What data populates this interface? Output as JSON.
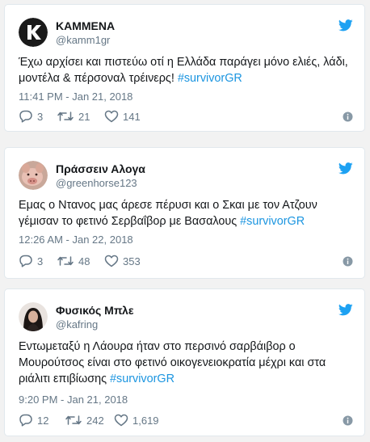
{
  "colors": {
    "background": "#f2f2f2",
    "card": "#ffffff",
    "text": "#14171a",
    "secondary": "#657786",
    "link": "#1b95e0",
    "bird": "#1da1f2"
  },
  "tweets": [
    {
      "display_name": "ΚΑΜΜΕΝΑ",
      "handle": "@kamm1gr",
      "text_lines": [
        "Έχω αρχίσει και πιστεύω οτί η Ελλάδα παράγει μόνο ελιές, λάδι,",
        "μοντέλα & πέρσοναλ τρέινερς! "
      ],
      "hashtag": "#survivorGR",
      "timestamp": "11:41 PM - Jan 21, 2018",
      "replies": "3",
      "retweets": "21",
      "likes": "141",
      "avatar_icon": "kammena-logo-avatar"
    },
    {
      "display_name": "Πράσσειν Αλογα",
      "handle": "@greenhorse123",
      "text_lines": [
        "Εμας ο Ντανος μας άρεσε πέρυσι και ο Σκαι με τον Ατζουν",
        "γέμισαν το φετινό Σερβαΐβορ με Βασαλους "
      ],
      "hashtag": "#survivorGR",
      "timestamp": "12:26 AM - Jan 22, 2018",
      "replies": "3",
      "retweets": "48",
      "likes": "353",
      "avatar_icon": "pig-photo-avatar"
    },
    {
      "display_name": "Φυσικός Μπλε",
      "handle": "@kafring",
      "text_lines": [
        "Εντωμεταξύ η Λάουρα ήταν στο περσινό σαρβάιβορ ο",
        "Μουρούτσος είναι στο φετινό οικογενειοκρατία μέχρι και στα",
        "ριάλιτι επιβίωσης "
      ],
      "hashtag": "#survivorGR",
      "timestamp": "9:20 PM - Jan 21, 2018",
      "replies": "12",
      "retweets": "242",
      "likes": "1,619",
      "avatar_icon": "woman-portrait-avatar"
    }
  ]
}
